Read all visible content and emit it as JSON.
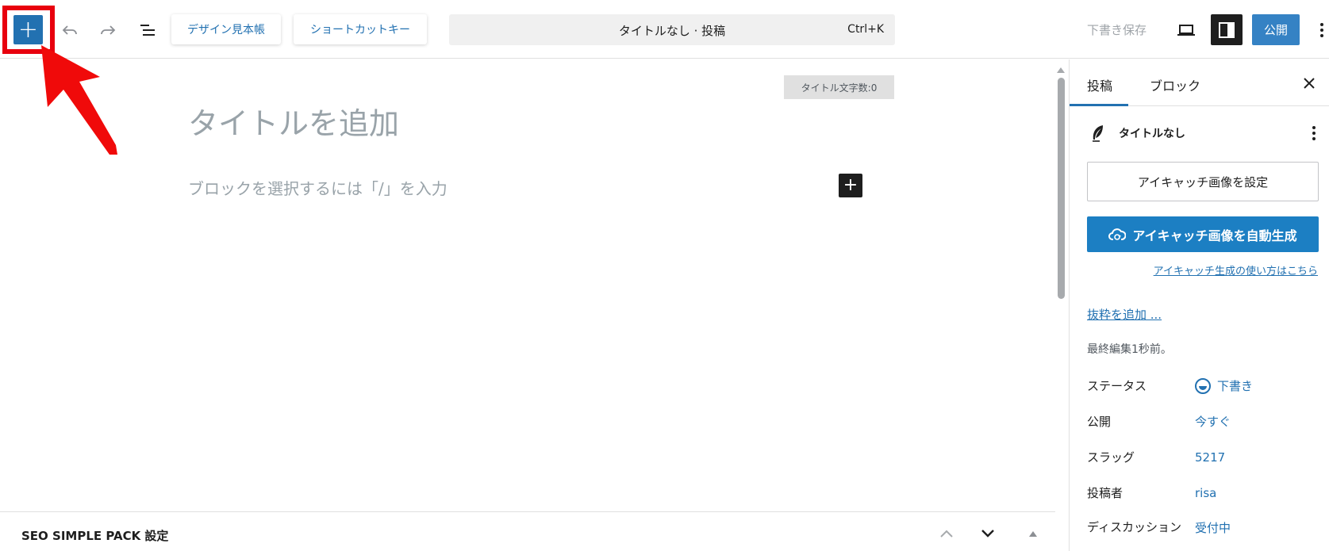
{
  "toolbar": {
    "inserter_symbol": "+",
    "pattern_button": "デザイン見本帳",
    "shortcut_button": "ショートカットキー",
    "command": {
      "title": "タイトルなし · 投稿",
      "shortcut": "Ctrl+K"
    },
    "save_draft": "下書き保存",
    "publish": "公開",
    "icons": [
      "plus-icon",
      "undo-icon",
      "redo-icon",
      "list-view-icon",
      "desktop-preview-icon",
      "sidebar-toggle-icon",
      "more-options-icon"
    ]
  },
  "editor": {
    "title_count": "タイトル文字数:0",
    "title_placeholder": "タイトルを追加",
    "block_placeholder": "ブロックを選択するには「/」を入力",
    "add_block_symbol": "+"
  },
  "metabox": {
    "title": "SEO SIMPLE PACK 設定"
  },
  "sidebar": {
    "tabs": [
      "投稿",
      "ブロック"
    ],
    "active_tab": "投稿",
    "post_title": "タイトルなし",
    "featured_image_button": "アイキャッチ画像を設定",
    "generate_button": "アイキャッチ画像を自動生成",
    "howto_link": "アイキャッチ生成の使い方はこちら",
    "excerpt_link": "抜粋を追加 ...",
    "last_edited": "最終編集1秒前。",
    "meta": [
      {
        "label": "ステータス",
        "value": "下書き"
      },
      {
        "label": "公開",
        "value": "今すぐ"
      },
      {
        "label": "スラッグ",
        "value": "5217"
      },
      {
        "label": "投稿者",
        "value": "risa"
      },
      {
        "label": "ディスカッション",
        "value": "受付中"
      }
    ]
  },
  "colors": {
    "accent": "#2271b1",
    "highlight_annotation": "#e8000e",
    "dark": "#1e1e1e"
  }
}
